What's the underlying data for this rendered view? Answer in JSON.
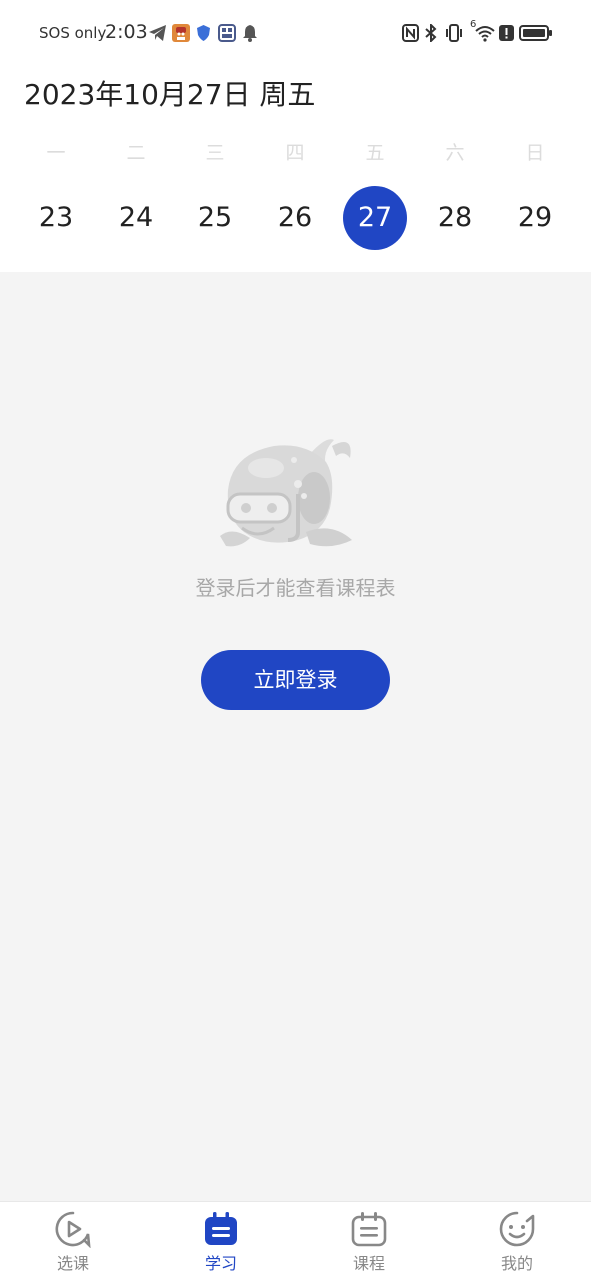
{
  "status_bar": {
    "carrier": "SOS only",
    "time": "2:03",
    "signal_label": "6"
  },
  "calendar": {
    "title": "2023年10月27日 周五",
    "weekdays": [
      "一",
      "二",
      "三",
      "四",
      "五",
      "六",
      "日"
    ],
    "days": [
      "23",
      "24",
      "25",
      "26",
      "27",
      "28",
      "29"
    ],
    "selected_day": "27"
  },
  "empty_state": {
    "message": "登录后才能查看课程表",
    "login_button": "立即登录"
  },
  "tabbar": {
    "tabs": [
      {
        "label": "选课",
        "icon": "play-bubble-icon"
      },
      {
        "label": "学习",
        "icon": "calendar-icon"
      },
      {
        "label": "课程",
        "icon": "schedule-icon"
      },
      {
        "label": "我的",
        "icon": "smiley-icon"
      }
    ],
    "active_tab": "学习"
  },
  "colors": {
    "accent": "#2046c4",
    "page_background": "#f4f4f4",
    "muted_text": "#a8a8a8",
    "weekday_text": "#dcdcdc"
  }
}
